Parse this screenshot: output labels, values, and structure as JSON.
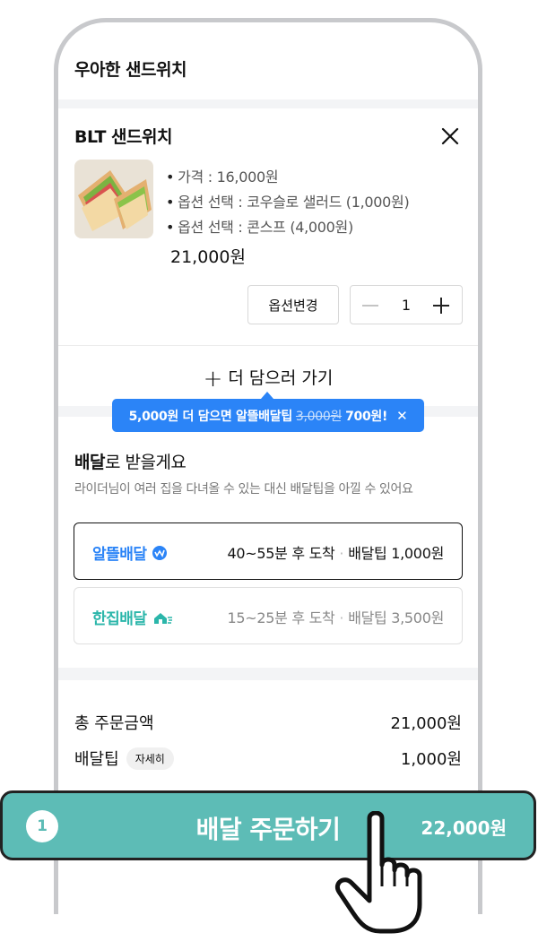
{
  "header": {
    "store_name": "우아한 샌드위치"
  },
  "cart_item": {
    "name": "BLT 샌드위치",
    "options": [
      "가격 : 16,000원",
      "옵션 선택 : 코우슬로 샐러드 (1,000원)",
      "옵션 선택 : 콘스프 (4,000원)"
    ],
    "price": "21,000원",
    "change_option_label": "옵션변경",
    "quantity": "1"
  },
  "add_more_label": "더 담으러 가기",
  "tooltip": {
    "text_before": "5,000원 더 담으면 알뜰배달팁",
    "old_fee": "3,000원",
    "new_fee": "700원!",
    "close": "✕"
  },
  "delivery": {
    "title_bold": "배달",
    "title_rest": "로 받을게요",
    "subtitle": "라이더님이 여러 집을 다녀올 수 있는 대신 배달팁을 아낄 수 있어요",
    "options": [
      {
        "brand": "알뜰배달",
        "eta": "40~55분 후 도착",
        "fee": "배달팁 1,000원",
        "color": "#2b84f7"
      },
      {
        "brand": "한집배달",
        "eta": "15~25분 후 도착",
        "fee": "배달팁 3,500원",
        "color": "#2bb6aa"
      }
    ]
  },
  "summary": {
    "total_label": "총 주문금액",
    "total_value": "21,000원",
    "fee_label": "배달팁",
    "fee_detail": "자세히",
    "fee_value": "1,000원"
  },
  "order_button": {
    "step": "1",
    "label": "배달 주문하기",
    "total": "22,000원",
    "color": "#5dbcb6"
  }
}
